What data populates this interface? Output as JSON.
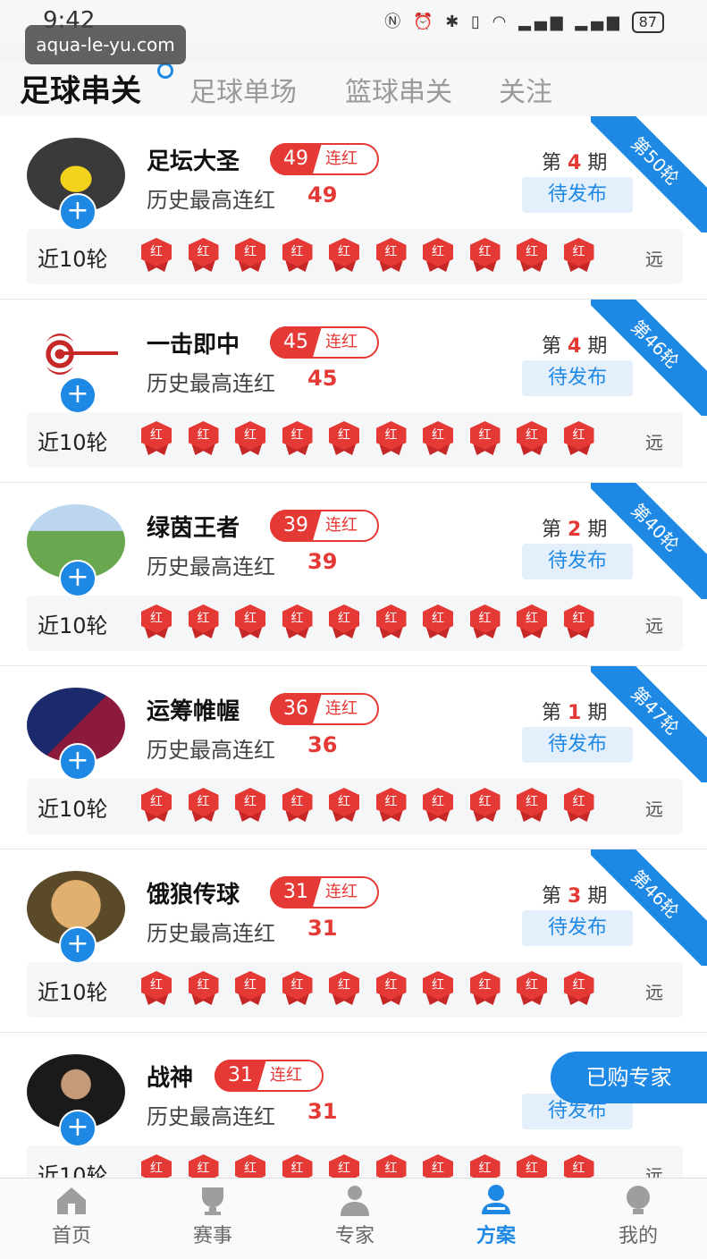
{
  "status_bar": {
    "time": "9:42",
    "battery": "87"
  },
  "watermark": "aqua-le-yu.com",
  "tabs": [
    {
      "label": "足球串关",
      "active": true
    },
    {
      "label": "足球单场",
      "active": false
    },
    {
      "label": "篮球串关",
      "active": false
    },
    {
      "label": "关注",
      "active": false
    }
  ],
  "labels": {
    "streak": "连红",
    "history_prefix": "历史最高连红",
    "pending": "待发布",
    "recent": "近10轮",
    "far": "远",
    "medal": "红",
    "period_prefix": "第",
    "period_suffix": "期"
  },
  "experts": [
    {
      "name": "足坛大圣",
      "streak": "49",
      "history": "49",
      "period": "4",
      "ribbon": "第50轮"
    },
    {
      "name": "一击即中",
      "streak": "45",
      "history": "45",
      "period": "4",
      "ribbon": "第46轮"
    },
    {
      "name": "绿茵王者",
      "streak": "39",
      "history": "39",
      "period": "2",
      "ribbon": "第40轮"
    },
    {
      "name": "运筹帷幄",
      "streak": "36",
      "history": "36",
      "period": "1",
      "ribbon": "第47轮"
    },
    {
      "name": "饿狼传球",
      "streak": "31",
      "history": "31",
      "period": "3",
      "ribbon": "第46轮"
    },
    {
      "name": "战神",
      "streak": "31",
      "history": "31",
      "period": "",
      "ribbon": ""
    }
  ],
  "float_button": "已购专家",
  "bottom_nav": [
    {
      "label": "首页",
      "icon": "home-icon",
      "active": false
    },
    {
      "label": "赛事",
      "icon": "trophy-icon",
      "active": false
    },
    {
      "label": "专家",
      "icon": "expert-icon",
      "active": false
    },
    {
      "label": "方案",
      "icon": "plan-icon",
      "active": true
    },
    {
      "label": "我的",
      "icon": "profile-icon",
      "active": false
    }
  ],
  "colors": {
    "accent": "#1e88e5",
    "red": "#e53935"
  }
}
